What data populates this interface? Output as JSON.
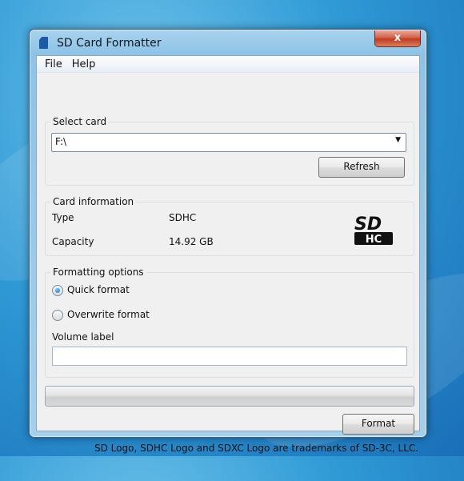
{
  "window": {
    "title": "SD Card Formatter",
    "close_glyph": "x"
  },
  "menu": {
    "items": [
      "File",
      "Help"
    ]
  },
  "select_card": {
    "legend": "Select card",
    "drive_value": "F:\\",
    "dropdown_arrow": "▼",
    "refresh_label": "Refresh"
  },
  "card_info": {
    "legend": "Card information",
    "type_label": "Type",
    "type_value": "SDHC",
    "capacity_label": "Capacity",
    "capacity_value": "14.92 GB",
    "logo_text": "SD",
    "logo_sub": "HC"
  },
  "formatting": {
    "legend": "Formatting options",
    "quick_format_label": "Quick format",
    "overwrite_format_label": "Overwrite format",
    "selected": "quick",
    "volume_label_caption": "Volume label",
    "volume_label_value": ""
  },
  "progress": {
    "fraction": 0
  },
  "actions": {
    "format_label": "Format"
  },
  "footer": {
    "trademark_text": "SD Logo, SDHC Logo and SDXC Logo are trademarks of SD-3C, LLC."
  }
}
